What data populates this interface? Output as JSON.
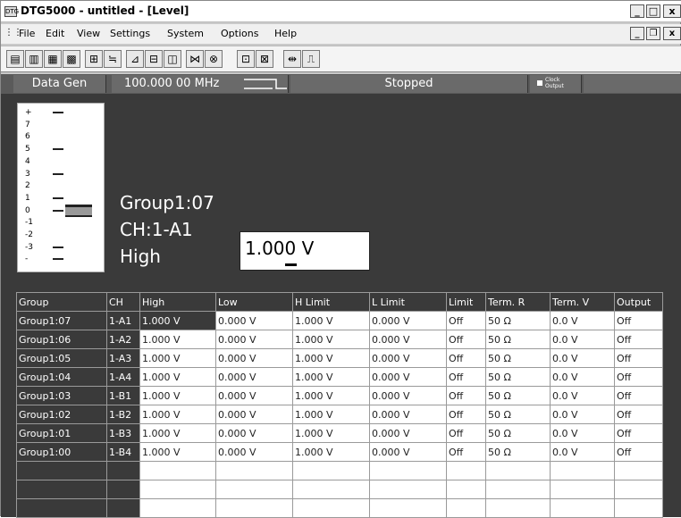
{
  "window": {
    "icon_label": "DTG",
    "title": "DTG5000 - untitled - [Level]",
    "min_label": "_",
    "max_label": "□",
    "close_label": "x",
    "mdi_min_label": "_",
    "mdi_restore_label": "❐",
    "mdi_close_label": "x"
  },
  "menu": {
    "items": [
      "File",
      "Edit",
      "View",
      "Settings",
      "System",
      "Options",
      "Help"
    ]
  },
  "toolbar": {
    "icons": [
      "print-icon",
      "print-preview-icon",
      "data-icon",
      "pattern-icon",
      "block-icon",
      "sequence-icon",
      "time-icon",
      "level-icon",
      "edit-icon",
      "jump-icon",
      "output-icon",
      "channel-icon",
      "group-icon",
      "delay-icon",
      "pulse-icon"
    ]
  },
  "status": {
    "mode": "Data Gen",
    "frequency": "100.000 00 MHz",
    "run_state": "Stopped",
    "clock_output_line1": "Clock",
    "clock_output_line2": "Output"
  },
  "level": {
    "ticks": [
      "+",
      "7",
      "6",
      "5",
      "4",
      "3",
      "2",
      "1",
      "0",
      "-1",
      "-2",
      "-3",
      "-"
    ],
    "group": "Group1:07",
    "channel": "CH:1-A1",
    "param": "High",
    "value": "1.000 V"
  },
  "table": {
    "headers": [
      "Group",
      "CH",
      "High",
      "Low",
      "H Limit",
      "L Limit",
      "Limit",
      "Term. R",
      "Term. V",
      "Output"
    ],
    "rows": [
      [
        "Group1:07",
        "1-A1",
        "1.000 V",
        "0.000 V",
        "1.000 V",
        "0.000 V",
        "Off",
        "50 Ω",
        "0.0 V",
        "Off"
      ],
      [
        "Group1:06",
        "1-A2",
        "1.000 V",
        "0.000 V",
        "1.000 V",
        "0.000 V",
        "Off",
        "50 Ω",
        "0.0 V",
        "Off"
      ],
      [
        "Group1:05",
        "1-A3",
        "1.000 V",
        "0.000 V",
        "1.000 V",
        "0.000 V",
        "Off",
        "50 Ω",
        "0.0 V",
        "Off"
      ],
      [
        "Group1:04",
        "1-A4",
        "1.000 V",
        "0.000 V",
        "1.000 V",
        "0.000 V",
        "Off",
        "50 Ω",
        "0.0 V",
        "Off"
      ],
      [
        "Group1:03",
        "1-B1",
        "1.000 V",
        "0.000 V",
        "1.000 V",
        "0.000 V",
        "Off",
        "50 Ω",
        "0.0 V",
        "Off"
      ],
      [
        "Group1:02",
        "1-B2",
        "1.000 V",
        "0.000 V",
        "1.000 V",
        "0.000 V",
        "Off",
        "50 Ω",
        "0.0 V",
        "Off"
      ],
      [
        "Group1:01",
        "1-B3",
        "1.000 V",
        "0.000 V",
        "1.000 V",
        "0.000 V",
        "Off",
        "50 Ω",
        "0.0 V",
        "Off"
      ],
      [
        "Group1:00",
        "1-B4",
        "1.000 V",
        "0.000 V",
        "1.000 V",
        "0.000 V",
        "Off",
        "50 Ω",
        "0.0 V",
        "Off"
      ]
    ],
    "empty_rows": 3
  },
  "colors": {
    "panel_dark": "#3a3a3a",
    "status_bar": "#5a5a5a"
  }
}
